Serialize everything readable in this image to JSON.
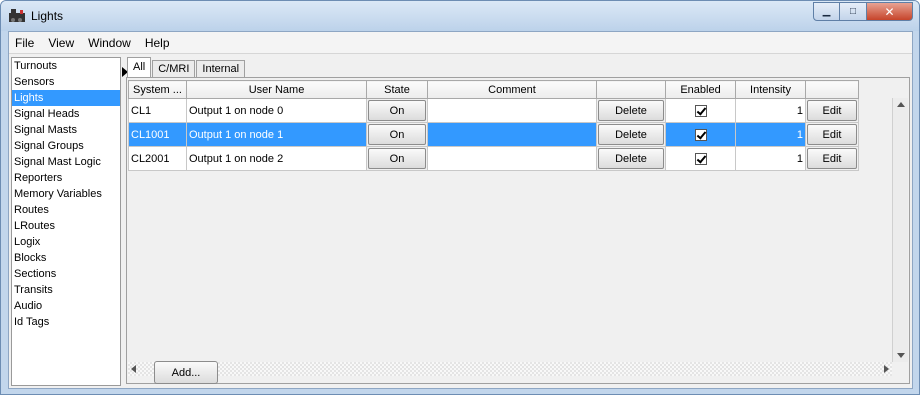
{
  "window": {
    "title": "Lights",
    "minimize": "▁",
    "maximize": "□",
    "close": "✕"
  },
  "menubar": [
    "File",
    "View",
    "Window",
    "Help"
  ],
  "sidebar": {
    "selected": "Lights",
    "items": [
      "Turnouts",
      "Sensors",
      "Lights",
      "Signal Heads",
      "Signal Masts",
      "Signal Groups",
      "Signal Mast Logic",
      "Reporters",
      "Memory Variables",
      "Routes",
      "LRoutes",
      "Logix",
      "Blocks",
      "Sections",
      "Transits",
      "Audio",
      "Id Tags"
    ]
  },
  "tabs": [
    "All",
    "C/MRI",
    "Internal"
  ],
  "table": {
    "columns": [
      "System ...",
      "User Name",
      "State",
      "Comment",
      "",
      "Enabled",
      "Intensity",
      ""
    ],
    "rows": [
      {
        "system": "CL1",
        "user_name": "Output 1 on node 0",
        "state": "On",
        "comment": "",
        "delete": "Delete",
        "enabled": true,
        "intensity": "1",
        "edit": "Edit",
        "selected": false
      },
      {
        "system": "CL1001",
        "user_name": "Output 1 on node 1",
        "state": "On",
        "comment": "",
        "delete": "Delete",
        "enabled": true,
        "intensity": "1",
        "edit": "Edit",
        "selected": true
      },
      {
        "system": "CL2001",
        "user_name": "Output 1 on node 2",
        "state": "On",
        "comment": "",
        "delete": "Delete",
        "enabled": true,
        "intensity": "1",
        "edit": "Edit",
        "selected": false
      }
    ]
  },
  "add_button": "Add..."
}
